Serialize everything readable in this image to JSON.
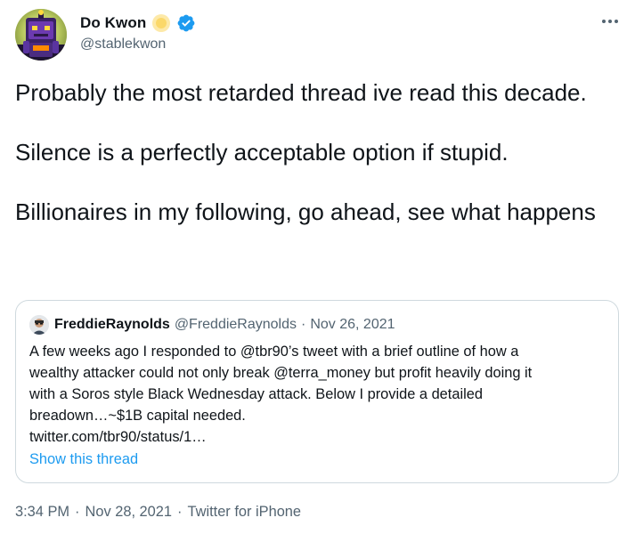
{
  "author": {
    "name": "Do Kwon",
    "handle": "@stablekwon",
    "avatar_icon": "robot-avatar",
    "badges": [
      "sun-emoji-icon",
      "verified-badge-icon"
    ]
  },
  "tweet": {
    "paragraphs": [
      "Probably the most retarded thread ive read this decade.",
      "Silence is a perfectly acceptable option if stupid.",
      "Billionaires in my following, go ahead, see what happens"
    ]
  },
  "quote": {
    "name": "FreddieRaynolds",
    "handle": "@FreddieRaynolds",
    "separator": "·",
    "date": "Nov 26, 2021",
    "text_lines": [
      "A few weeks ago I responded to @tbr90’s tweet with a brief outline of how a",
      "wealthy attacker could not only break @terra_money but profit heavily doing it",
      "with a Soros style Black Wednesday attack. Below I provide a detailed",
      "breadown…~$1B capital needed.",
      "twitter.com/tbr90/status/1…"
    ],
    "show_thread": "Show this thread"
  },
  "meta": {
    "time": "3:34 PM",
    "separator": "·",
    "date": "Nov 28, 2021",
    "source": "Twitter for iPhone"
  },
  "colors": {
    "text": "#0f1419",
    "secondary": "#536471",
    "link": "#1d9bf0",
    "border": "#cfd9de",
    "verified": "#1d9bf0"
  }
}
